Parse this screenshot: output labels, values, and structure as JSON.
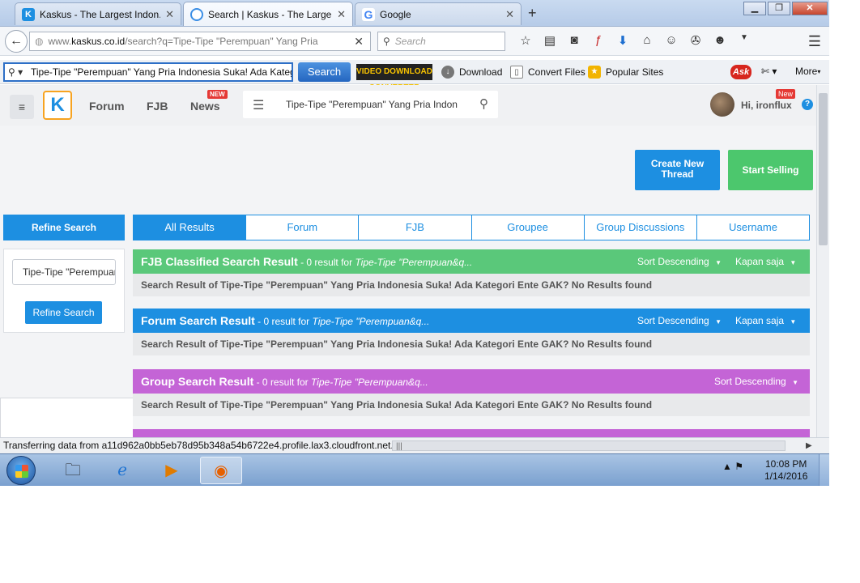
{
  "browser": {
    "tabs": [
      {
        "title": "Kaskus - The Largest Indon...",
        "close": "✕"
      },
      {
        "title": "Search | Kaskus - The Large...",
        "close": "✕"
      },
      {
        "title": "Google",
        "close": "✕"
      }
    ],
    "new_tab": "+",
    "url_prefix": "www.",
    "url_domain": "kaskus.co.id",
    "url_rest": "/search?q=Tipe-Tipe \"Perempuan\" Yang Pria",
    "search_placeholder": "Search"
  },
  "ask_toolbar": {
    "query": "Tipe-Tipe \"Perempuan\" Yang Pria Indonesia Suka! Ada Kateg",
    "search_button": "Search",
    "vdc_label": "VIDEO DOWNLOAD CONVERTER",
    "download": "Download",
    "convert": "Convert Files",
    "popular": "Popular Sites",
    "ask": "Ask",
    "more": "More"
  },
  "kaskus": {
    "nav": {
      "forum": "Forum",
      "fjb": "FJB",
      "news": "News",
      "news_badge": "NEW"
    },
    "search_query": "Tipe-Tipe \"Perempuan\" Yang Pria Indon",
    "user_greeting": "Hi, ironflux",
    "user_badge": "New",
    "help": "?",
    "create_thread": "Create New Thread",
    "start_selling": "Start Selling",
    "refine": {
      "heading": "Refine Search",
      "input_value": "Tipe-Tipe \"Perempuan",
      "button": "Refine Search"
    },
    "tabs": [
      "All Results",
      "Forum",
      "FJB",
      "Groupee",
      "Group Discussions",
      "Username"
    ],
    "sections": [
      {
        "title": "FJB Classified Search Result",
        "count": " - 0 result for ",
        "query": "Tipe-Tipe \"Perempuan&q...",
        "sort": "Sort Descending",
        "time": "Kapan saja",
        "body": "Search Result of Tipe-Tipe \"Perempuan\" Yang Pria Indonesia Suka! Ada Kategori Ente GAK? No Results found"
      },
      {
        "title": "Forum Search Result",
        "count": " - 0 result for ",
        "query": "Tipe-Tipe \"Perempuan&q...",
        "sort": "Sort Descending",
        "time": "Kapan saja",
        "body": "Search Result of Tipe-Tipe \"Perempuan\" Yang Pria Indonesia Suka! Ada Kategori Ente GAK? No Results found"
      },
      {
        "title": "Group Search Result",
        "count": " - 0 result for ",
        "query": "Tipe-Tipe \"Perempuan&q...",
        "sort": "Sort Descending",
        "body": "Search Result of Tipe-Tipe \"Perempuan\" Yang Pria Indonesia Suka! Ada Kategori Ente GAK? No Results found"
      }
    ]
  },
  "status": {
    "text": "Transferring data from a11d962a0bb5eb78d95b348a54b6722e4.profile.lax3.cloudfront.net..."
  },
  "taskbar": {
    "time": "10:08 PM",
    "date": "1/14/2016"
  },
  "colors": {
    "kaskus_blue": "#1d8fe1",
    "fjb_green": "#5ac87a",
    "sell_green": "#4cc76d",
    "group_purple": "#c464d6",
    "badge_red": "#e53935"
  }
}
